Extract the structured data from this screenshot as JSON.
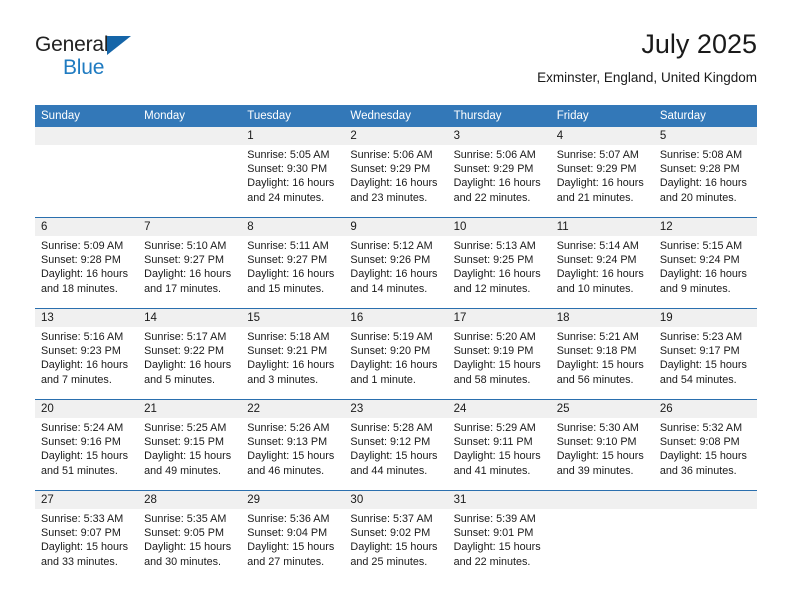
{
  "brand": {
    "line1": "General",
    "line2": "Blue"
  },
  "header": {
    "title": "July 2025",
    "subtitle": "Exminster, England, United Kingdom"
  },
  "colors": {
    "header_bar": "#3378b8",
    "row_divider": "#2a6fae",
    "daynum_band": "#f0f0f0",
    "brand_blue": "#1f7bc1",
    "text": "#1a1a1a"
  },
  "weekdays": [
    "Sunday",
    "Monday",
    "Tuesday",
    "Wednesday",
    "Thursday",
    "Friday",
    "Saturday"
  ],
  "labels": {
    "sunrise_prefix": "Sunrise:",
    "sunset_prefix": "Sunset:",
    "daylight_prefix": "Daylight:"
  },
  "weeks": [
    [
      {
        "day": "",
        "empty": true
      },
      {
        "day": "",
        "empty": true
      },
      {
        "day": "1",
        "sunrise": "Sunrise: 5:05 AM",
        "sunset": "Sunset: 9:30 PM",
        "daylight1": "Daylight: 16 hours",
        "daylight2": "and 24 minutes."
      },
      {
        "day": "2",
        "sunrise": "Sunrise: 5:06 AM",
        "sunset": "Sunset: 9:29 PM",
        "daylight1": "Daylight: 16 hours",
        "daylight2": "and 23 minutes."
      },
      {
        "day": "3",
        "sunrise": "Sunrise: 5:06 AM",
        "sunset": "Sunset: 9:29 PM",
        "daylight1": "Daylight: 16 hours",
        "daylight2": "and 22 minutes."
      },
      {
        "day": "4",
        "sunrise": "Sunrise: 5:07 AM",
        "sunset": "Sunset: 9:29 PM",
        "daylight1": "Daylight: 16 hours",
        "daylight2": "and 21 minutes."
      },
      {
        "day": "5",
        "sunrise": "Sunrise: 5:08 AM",
        "sunset": "Sunset: 9:28 PM",
        "daylight1": "Daylight: 16 hours",
        "daylight2": "and 20 minutes."
      }
    ],
    [
      {
        "day": "6",
        "sunrise": "Sunrise: 5:09 AM",
        "sunset": "Sunset: 9:28 PM",
        "daylight1": "Daylight: 16 hours",
        "daylight2": "and 18 minutes."
      },
      {
        "day": "7",
        "sunrise": "Sunrise: 5:10 AM",
        "sunset": "Sunset: 9:27 PM",
        "daylight1": "Daylight: 16 hours",
        "daylight2": "and 17 minutes."
      },
      {
        "day": "8",
        "sunrise": "Sunrise: 5:11 AM",
        "sunset": "Sunset: 9:27 PM",
        "daylight1": "Daylight: 16 hours",
        "daylight2": "and 15 minutes."
      },
      {
        "day": "9",
        "sunrise": "Sunrise: 5:12 AM",
        "sunset": "Sunset: 9:26 PM",
        "daylight1": "Daylight: 16 hours",
        "daylight2": "and 14 minutes."
      },
      {
        "day": "10",
        "sunrise": "Sunrise: 5:13 AM",
        "sunset": "Sunset: 9:25 PM",
        "daylight1": "Daylight: 16 hours",
        "daylight2": "and 12 minutes."
      },
      {
        "day": "11",
        "sunrise": "Sunrise: 5:14 AM",
        "sunset": "Sunset: 9:24 PM",
        "daylight1": "Daylight: 16 hours",
        "daylight2": "and 10 minutes."
      },
      {
        "day": "12",
        "sunrise": "Sunrise: 5:15 AM",
        "sunset": "Sunset: 9:24 PM",
        "daylight1": "Daylight: 16 hours",
        "daylight2": "and 9 minutes."
      }
    ],
    [
      {
        "day": "13",
        "sunrise": "Sunrise: 5:16 AM",
        "sunset": "Sunset: 9:23 PM",
        "daylight1": "Daylight: 16 hours",
        "daylight2": "and 7 minutes."
      },
      {
        "day": "14",
        "sunrise": "Sunrise: 5:17 AM",
        "sunset": "Sunset: 9:22 PM",
        "daylight1": "Daylight: 16 hours",
        "daylight2": "and 5 minutes."
      },
      {
        "day": "15",
        "sunrise": "Sunrise: 5:18 AM",
        "sunset": "Sunset: 9:21 PM",
        "daylight1": "Daylight: 16 hours",
        "daylight2": "and 3 minutes."
      },
      {
        "day": "16",
        "sunrise": "Sunrise: 5:19 AM",
        "sunset": "Sunset: 9:20 PM",
        "daylight1": "Daylight: 16 hours",
        "daylight2": "and 1 minute."
      },
      {
        "day": "17",
        "sunrise": "Sunrise: 5:20 AM",
        "sunset": "Sunset: 9:19 PM",
        "daylight1": "Daylight: 15 hours",
        "daylight2": "and 58 minutes."
      },
      {
        "day": "18",
        "sunrise": "Sunrise: 5:21 AM",
        "sunset": "Sunset: 9:18 PM",
        "daylight1": "Daylight: 15 hours",
        "daylight2": "and 56 minutes."
      },
      {
        "day": "19",
        "sunrise": "Sunrise: 5:23 AM",
        "sunset": "Sunset: 9:17 PM",
        "daylight1": "Daylight: 15 hours",
        "daylight2": "and 54 minutes."
      }
    ],
    [
      {
        "day": "20",
        "sunrise": "Sunrise: 5:24 AM",
        "sunset": "Sunset: 9:16 PM",
        "daylight1": "Daylight: 15 hours",
        "daylight2": "and 51 minutes."
      },
      {
        "day": "21",
        "sunrise": "Sunrise: 5:25 AM",
        "sunset": "Sunset: 9:15 PM",
        "daylight1": "Daylight: 15 hours",
        "daylight2": "and 49 minutes."
      },
      {
        "day": "22",
        "sunrise": "Sunrise: 5:26 AM",
        "sunset": "Sunset: 9:13 PM",
        "daylight1": "Daylight: 15 hours",
        "daylight2": "and 46 minutes."
      },
      {
        "day": "23",
        "sunrise": "Sunrise: 5:28 AM",
        "sunset": "Sunset: 9:12 PM",
        "daylight1": "Daylight: 15 hours",
        "daylight2": "and 44 minutes."
      },
      {
        "day": "24",
        "sunrise": "Sunrise: 5:29 AM",
        "sunset": "Sunset: 9:11 PM",
        "daylight1": "Daylight: 15 hours",
        "daylight2": "and 41 minutes."
      },
      {
        "day": "25",
        "sunrise": "Sunrise: 5:30 AM",
        "sunset": "Sunset: 9:10 PM",
        "daylight1": "Daylight: 15 hours",
        "daylight2": "and 39 minutes."
      },
      {
        "day": "26",
        "sunrise": "Sunrise: 5:32 AM",
        "sunset": "Sunset: 9:08 PM",
        "daylight1": "Daylight: 15 hours",
        "daylight2": "and 36 minutes."
      }
    ],
    [
      {
        "day": "27",
        "sunrise": "Sunrise: 5:33 AM",
        "sunset": "Sunset: 9:07 PM",
        "daylight1": "Daylight: 15 hours",
        "daylight2": "and 33 minutes."
      },
      {
        "day": "28",
        "sunrise": "Sunrise: 5:35 AM",
        "sunset": "Sunset: 9:05 PM",
        "daylight1": "Daylight: 15 hours",
        "daylight2": "and 30 minutes."
      },
      {
        "day": "29",
        "sunrise": "Sunrise: 5:36 AM",
        "sunset": "Sunset: 9:04 PM",
        "daylight1": "Daylight: 15 hours",
        "daylight2": "and 27 minutes."
      },
      {
        "day": "30",
        "sunrise": "Sunrise: 5:37 AM",
        "sunset": "Sunset: 9:02 PM",
        "daylight1": "Daylight: 15 hours",
        "daylight2": "and 25 minutes."
      },
      {
        "day": "31",
        "sunrise": "Sunrise: 5:39 AM",
        "sunset": "Sunset: 9:01 PM",
        "daylight1": "Daylight: 15 hours",
        "daylight2": "and 22 minutes."
      },
      {
        "day": "",
        "empty": true
      },
      {
        "day": "",
        "empty": true
      }
    ]
  ]
}
